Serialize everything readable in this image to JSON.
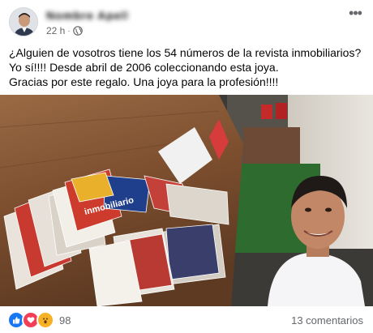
{
  "post": {
    "author": "Nombre Apellido",
    "time": "22 h",
    "separator": "·",
    "text_lines": [
      "¿Alguien de vosotros tiene los 54 números de la revista inmobiliarios? Yo sí!!!! Desde abril de 2006 coleccionando esta joya.",
      "Gracias por este regalo. Una joya para la profesión!!!!"
    ],
    "icons": {
      "menu": "more-horizontal-icon",
      "audience": "globe-icon",
      "like": "like-icon",
      "love": "love-icon",
      "wow": "wow-icon"
    },
    "photo_alt": "Hombre con revistas inmobiliarias sobre una mesa de madera",
    "magazine_title": "inmobiliario",
    "reactions": {
      "count": "98"
    },
    "comments_label": "13 comentarios"
  },
  "colors": {
    "like": "#1877f2",
    "love": "#f33e58",
    "wow": "#f7b125",
    "secondary_text": "#65676b"
  }
}
